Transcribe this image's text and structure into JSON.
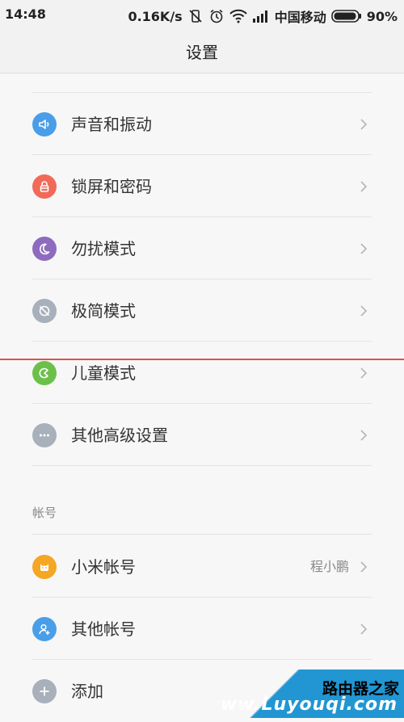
{
  "status_bar": {
    "time": "14:48",
    "network_speed": "0.16K/s",
    "carrier": "中国移动",
    "battery": "90%"
  },
  "header": {
    "title": "设置"
  },
  "settings": {
    "items": [
      {
        "label": "声音和振动",
        "icon": "speaker-icon",
        "color": "#4a9ee8"
      },
      {
        "label": "锁屏和密码",
        "icon": "lock-icon",
        "color": "#f06a5a"
      },
      {
        "label": "勿扰模式",
        "icon": "moon-icon",
        "color": "#8e6bbf"
      },
      {
        "label": "极简模式",
        "icon": "simple-mode-icon",
        "color": "#a7b0bb"
      },
      {
        "label": "儿童模式",
        "icon": "child-mode-icon",
        "color": "#6cc04a"
      },
      {
        "label": "其他高级设置",
        "icon": "more-icon",
        "color": "#a7b0bb"
      }
    ]
  },
  "accounts": {
    "header": "帐号",
    "items": [
      {
        "label": "小米帐号",
        "value": "程小鹏",
        "icon": "mi-account-icon",
        "color": "#f5a623"
      },
      {
        "label": "其他帐号",
        "icon": "person-add-icon",
        "color": "#4a9ee8"
      },
      {
        "label": "添加",
        "icon": "add-icon",
        "color": "#a7b0bb"
      }
    ]
  },
  "watermark": {
    "line1": "路由器之家",
    "line2": "www.Luyouqi.com"
  }
}
